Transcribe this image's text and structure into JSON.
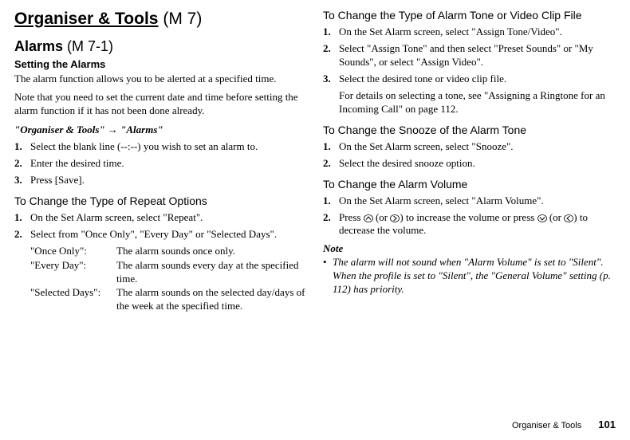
{
  "main": {
    "title": "Organiser & Tools",
    "menu_code": "(M 7)",
    "alarms": {
      "heading": "Alarms",
      "menu_code": "(M 7-1)",
      "setting_heading": "Setting the Alarms",
      "intro": "The alarm function allows you to be alerted at a specified time.",
      "note_prereq": "Note that you need to set the current date and time before setting the alarm function if it has not been done already.",
      "nav_prefix": "\"Organiser & Tools\"",
      "nav_suffix": "\"Alarms\"",
      "steps": [
        "Select the blank line (--:--) you wish to set an alarm to.",
        "Enter the desired time.",
        "Press [Save]."
      ]
    },
    "repeat": {
      "heading": "To Change the Type of Repeat Options",
      "steps": [
        "On the Set Alarm screen, select \"Repeat\".",
        "Select from \"Once Only\", \"Every Day\" or \"Selected Days\"."
      ],
      "defs": [
        {
          "term": "\"Once Only\":",
          "def": "The alarm sounds once only."
        },
        {
          "term": "\"Every Day\":",
          "def": "The alarm sounds every day at the specified time."
        },
        {
          "term": "\"Selected Days\":",
          "def": "The alarm sounds on the selected day/days of the week at the specified time."
        }
      ]
    }
  },
  "right": {
    "tone": {
      "heading": "To Change the Type of Alarm Tone or Video Clip File",
      "steps": [
        "On the Set Alarm screen, select \"Assign Tone/Video\".",
        "Select \"Assign Tone\" and then select \"Preset Sounds\" or \"My Sounds\", or select \"Assign Video\".",
        "Select the desired tone or video clip file."
      ],
      "subtext": "For details on selecting a tone, see \"Assigning a Ringtone for an Incoming Call\" on page 112."
    },
    "snooze": {
      "heading": "To Change the Snooze of the Alarm Tone",
      "steps": [
        "On the Set Alarm screen, select \"Snooze\".",
        "Select the desired snooze option."
      ]
    },
    "volume": {
      "heading": "To Change the Alarm Volume",
      "step1": "On the Set Alarm screen, select \"Alarm Volume\".",
      "step2_a": "Press ",
      "step2_b": " (or ",
      "step2_c": ") to increase the volume or press ",
      "step2_d": " (or ",
      "step2_e": ") to decrease the volume."
    },
    "note": {
      "label": "Note",
      "text": "The alarm will not sound when \"Alarm Volume\" is set to \"Silent\". When the profile is set to \"Silent\", the \"General Volume\" setting (p. 112) has priority."
    }
  },
  "footer": {
    "section": "Organiser & Tools",
    "page": "101"
  }
}
